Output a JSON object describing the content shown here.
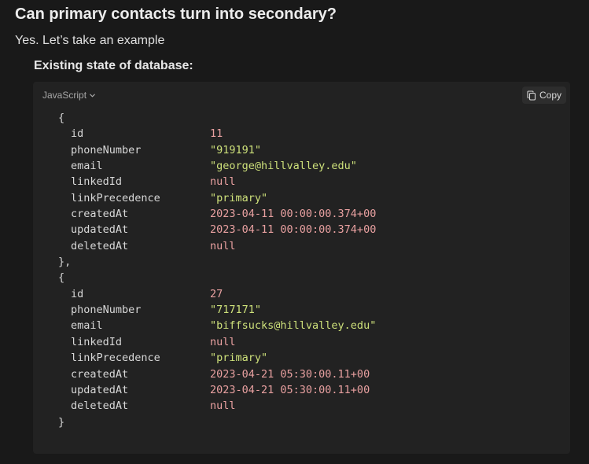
{
  "heading": "Can primary contacts turn into secondary?",
  "intro": "Yes. Let’s take an example",
  "subheading": "Existing state of database:",
  "code_block": {
    "language": "JavaScript",
    "copy_label": "Copy",
    "lines": [
      {
        "kind": "brace",
        "text": "{"
      },
      {
        "kind": "field",
        "key": "id",
        "value": "11",
        "type": "num"
      },
      {
        "kind": "field",
        "key": "phoneNumber",
        "value": "\"919191\"",
        "type": "str"
      },
      {
        "kind": "field",
        "key": "email",
        "value": "\"george@hillvalley.edu\"",
        "type": "str"
      },
      {
        "kind": "field",
        "key": "linkedId",
        "value": "null",
        "type": "kw"
      },
      {
        "kind": "field",
        "key": "linkPrecedence",
        "value": "\"primary\"",
        "type": "str"
      },
      {
        "kind": "field",
        "key": "createdAt",
        "value": "2023-04-11 00:00:00.374+00",
        "type": "num"
      },
      {
        "kind": "field",
        "key": "updatedAt",
        "value": "2023-04-11 00:00:00.374+00",
        "type": "num"
      },
      {
        "kind": "field",
        "key": "deletedAt",
        "value": "null",
        "type": "kw"
      },
      {
        "kind": "brace",
        "text": "},"
      },
      {
        "kind": "brace",
        "text": "{"
      },
      {
        "kind": "field",
        "key": "id",
        "value": "27",
        "type": "num"
      },
      {
        "kind": "field",
        "key": "phoneNumber",
        "value": "\"717171\"",
        "type": "str"
      },
      {
        "kind": "field",
        "key": "email",
        "value": "\"biffsucks@hillvalley.edu\"",
        "type": "str"
      },
      {
        "kind": "field",
        "key": "linkedId",
        "value": "null",
        "type": "kw"
      },
      {
        "kind": "field",
        "key": "linkPrecedence",
        "value": "\"primary\"",
        "type": "str"
      },
      {
        "kind": "field",
        "key": "createdAt",
        "value": "2023-04-21 05:30:00.11+00",
        "type": "num"
      },
      {
        "kind": "field",
        "key": "updatedAt",
        "value": "2023-04-21 05:30:00.11+00",
        "type": "num"
      },
      {
        "kind": "field",
        "key": "deletedAt",
        "value": "null",
        "type": "kw"
      },
      {
        "kind": "brace",
        "text": "}"
      }
    ]
  },
  "icons": {
    "language_dropdown": "chevron-down-icon",
    "copy": "copy-icon"
  }
}
